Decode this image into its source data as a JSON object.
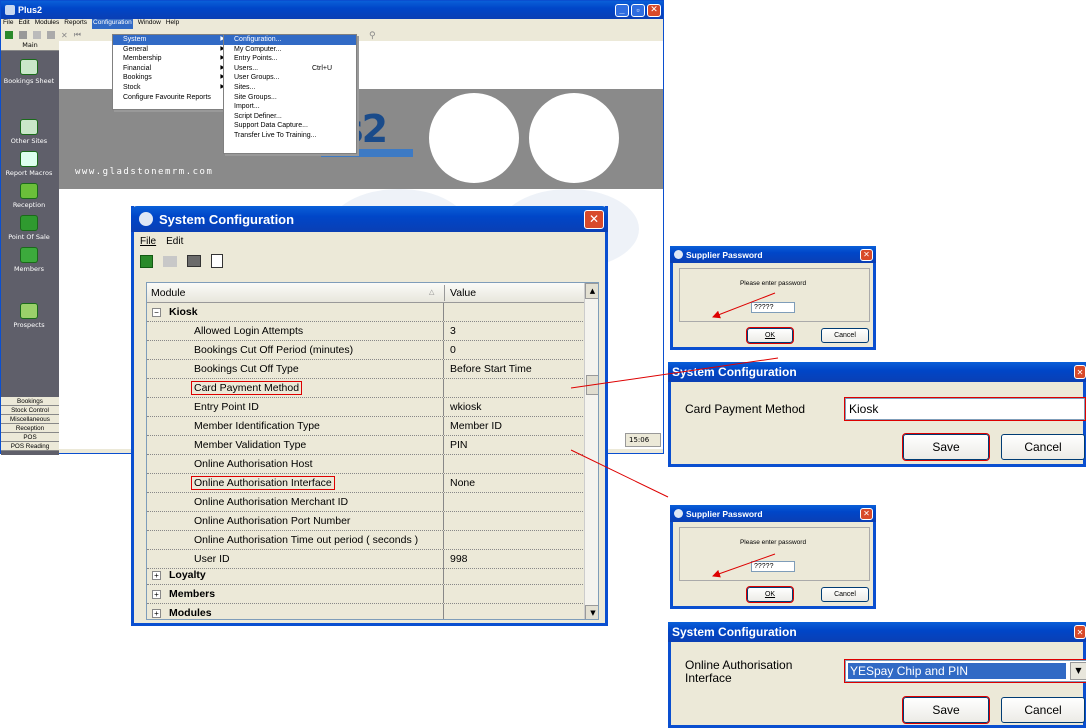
{
  "main_window": {
    "title": "Plus2",
    "menu_items": [
      "File",
      "Edit",
      "Modules",
      "Reports",
      "Configuration",
      "Window",
      "Help"
    ],
    "sidebar": {
      "top_label": "Main",
      "items": [
        "Bookings Sheet",
        "Other Sites",
        "Report Macros",
        "Reception",
        "Point Of Sale",
        "Members",
        "Prospects"
      ],
      "bottom_tabs": [
        "Bookings",
        "Stock Control",
        "Miscellaneous",
        "Reception",
        "POS",
        "POS Reading"
      ]
    },
    "banner_text": "www.gladstonemrm.com",
    "logo_text": "s2",
    "status_time": "15:06",
    "config_menu": {
      "items": [
        "System",
        "General",
        "Membership",
        "Financial",
        "Bookings",
        "Stock",
        "Configure Favourite Reports"
      ],
      "system_submenu": [
        "Configuration...",
        "My Computer...",
        "Entry Points...",
        "Users...",
        "User Groups...",
        "Sites...",
        "Site Groups...",
        "Import...",
        "Script Definer...",
        "Support Data Capture...",
        "Transfer Live To Training..."
      ],
      "users_shortcut": "Ctrl+U"
    }
  },
  "sys_config": {
    "title": "System Configuration",
    "menu": [
      "File",
      "Edit"
    ],
    "columns": [
      "Module",
      "Value"
    ],
    "group_kiosk": "Kiosk",
    "rows": [
      {
        "name": "Allowed Login Attempts",
        "value": "3"
      },
      {
        "name": "Bookings Cut Off Period (minutes)",
        "value": "0"
      },
      {
        "name": "Bookings Cut Off Type",
        "value": "Before Start Time"
      },
      {
        "name": "Card Payment Method",
        "value": ""
      },
      {
        "name": "Entry Point ID",
        "value": "wkiosk"
      },
      {
        "name": "Member Identification Type",
        "value": "Member ID"
      },
      {
        "name": "Member Validation Type",
        "value": "PIN"
      },
      {
        "name": "Online Authorisation Host",
        "value": ""
      },
      {
        "name": "Online Authorisation Interface",
        "value": "None"
      },
      {
        "name": "Online Authorisation Merchant ID",
        "value": ""
      },
      {
        "name": "Online Authorisation Port Number",
        "value": ""
      },
      {
        "name": "Online Authorisation Time out period ( seconds )",
        "value": ""
      },
      {
        "name": "User ID",
        "value": "998"
      }
    ],
    "collapsed_groups": [
      "Loyalty",
      "Members",
      "Modules"
    ]
  },
  "supplier_dialog_1": {
    "title": "Supplier Password",
    "prompt": "Please enter password",
    "password_value": "?????",
    "ok": "OK",
    "cancel": "Cancel"
  },
  "edit_dialog_1": {
    "title": "System Configuration",
    "label": "Card Payment Method",
    "value": "Kiosk",
    "save": "Save",
    "cancel": "Cancel"
  },
  "supplier_dialog_2": {
    "title": "Supplier Password",
    "prompt": "Please enter password",
    "password_value": "?????",
    "ok": "OK",
    "cancel": "Cancel"
  },
  "edit_dialog_2": {
    "title": "System Configuration",
    "label": "Online Authorisation Interface",
    "value": "YESpay Chip and PIN",
    "save": "Save",
    "cancel": "Cancel"
  },
  "colors": {
    "xp_blue": "#0046c8",
    "sidebar_bg": "#5f5f6a",
    "highlight": "#316ac5",
    "callout_red": "#dd0000"
  }
}
